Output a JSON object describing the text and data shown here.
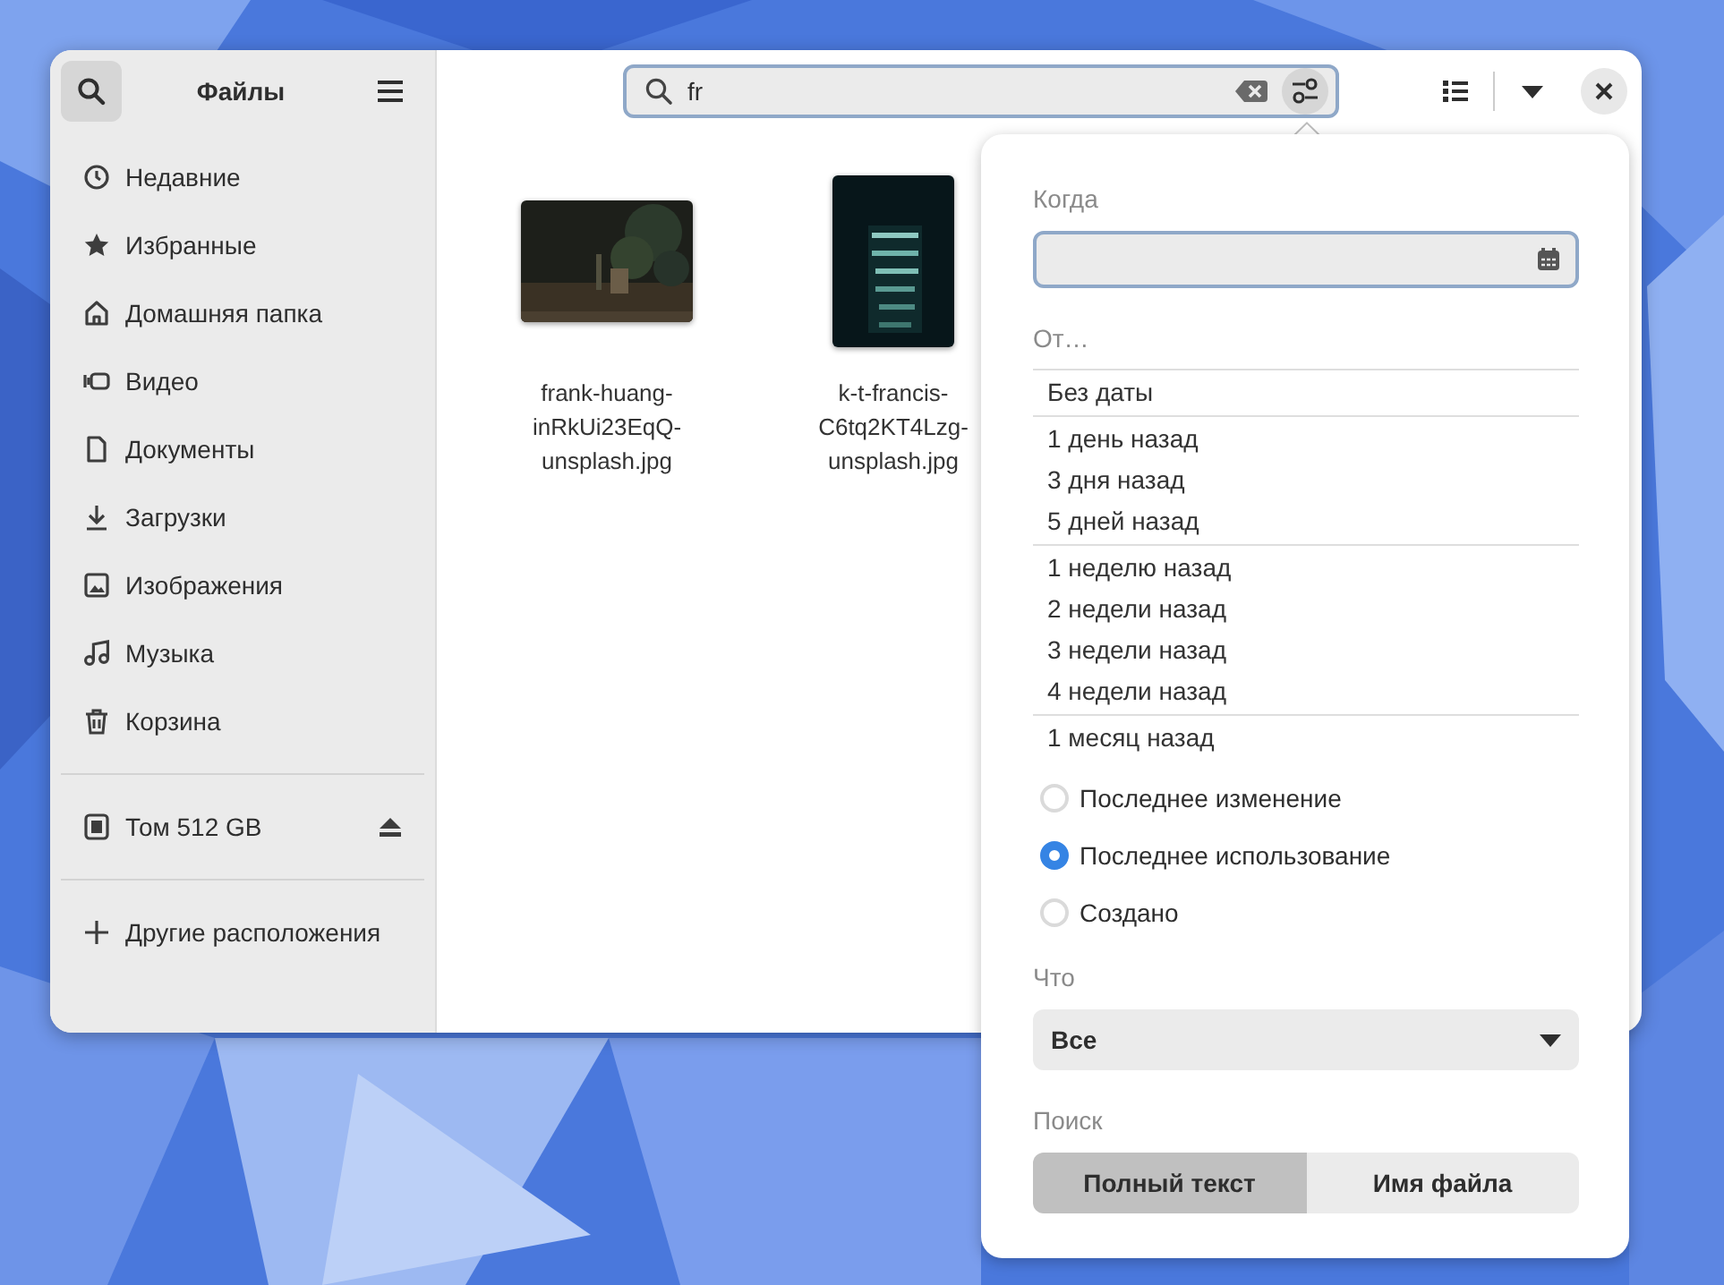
{
  "sidebar": {
    "title": "Файлы",
    "places": [
      {
        "kind": "recent",
        "label": "Недавние"
      },
      {
        "kind": "starred",
        "label": "Избранные"
      },
      {
        "kind": "home",
        "label": "Домашняя папка"
      },
      {
        "kind": "video",
        "label": "Видео"
      },
      {
        "kind": "documents",
        "label": "Документы"
      },
      {
        "kind": "downloads",
        "label": "Загрузки"
      },
      {
        "kind": "pictures",
        "label": "Изображения"
      },
      {
        "kind": "music",
        "label": "Музыка"
      },
      {
        "kind": "trash",
        "label": "Корзина"
      }
    ],
    "volumes": [
      {
        "label": "Том 512 GB"
      }
    ],
    "other": {
      "label": "Другие расположения"
    }
  },
  "search": {
    "value": "fr"
  },
  "files": [
    {
      "name": "frank-huang-inRkUi23EqQ-unsplash.jpg",
      "kind": "landscape"
    },
    {
      "name": "k-t-francis-C6tq2KT4Lzg-unsplash.jpg",
      "kind": "portrait"
    }
  ],
  "filter_popover": {
    "when_label": "Когда",
    "from_label": "От…",
    "date_groups": [
      [
        "Без даты"
      ],
      [
        "1 день назад",
        "3 дня назад",
        "5 дней назад"
      ],
      [
        "1 неделю назад",
        "2 недели назад",
        "3 недели назад",
        "4 недели назад"
      ],
      [
        "1 месяц назад"
      ]
    ],
    "date_types": [
      {
        "label": "Последнее изменение",
        "selected": false
      },
      {
        "label": "Последнее использование",
        "selected": true
      },
      {
        "label": "Создано",
        "selected": false
      }
    ],
    "what_label": "Что",
    "what_value": "Все",
    "search_label": "Поиск",
    "search_modes": [
      {
        "label": "Полный текст",
        "selected": true
      },
      {
        "label": "Имя файла",
        "selected": false
      }
    ]
  }
}
